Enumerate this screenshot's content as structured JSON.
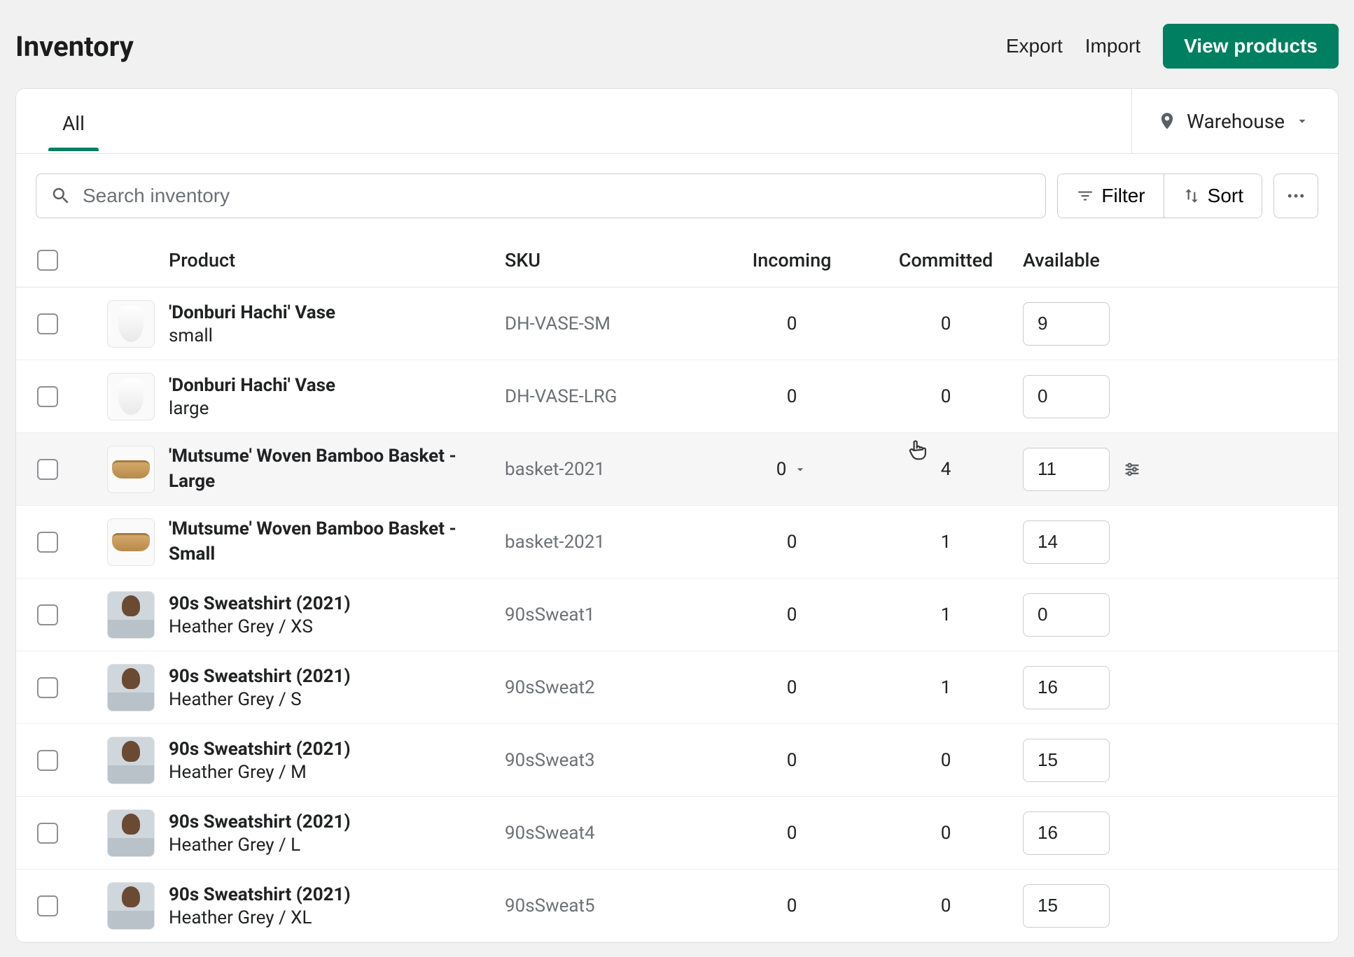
{
  "header": {
    "title": "Inventory",
    "export": "Export",
    "import": "Import",
    "view_products": "View products"
  },
  "tabs": {
    "all": "All"
  },
  "location": {
    "label": "Warehouse"
  },
  "toolbar": {
    "search_placeholder": "Search inventory",
    "filter": "Filter",
    "sort": "Sort"
  },
  "columns": {
    "product": "Product",
    "sku": "SKU",
    "incoming": "Incoming",
    "committed": "Committed",
    "available": "Available"
  },
  "rows": [
    {
      "name": "'Donburi Hachi' Vase",
      "variant": "small",
      "sku": "DH-VASE-SM",
      "incoming": "0",
      "committed": "0",
      "available": "9",
      "thumb": "vase"
    },
    {
      "name": "'Donburi Hachi' Vase",
      "variant": "large",
      "sku": "DH-VASE-LRG",
      "incoming": "0",
      "committed": "0",
      "available": "0",
      "thumb": "vase"
    },
    {
      "name": "'Mutsume' Woven Bamboo Basket - Large",
      "variant": "",
      "sku": "basket-2021",
      "incoming": "0",
      "committed": "4",
      "available": "11",
      "thumb": "basket",
      "hovered": true
    },
    {
      "name": "'Mutsume' Woven Bamboo Basket - Small",
      "variant": "",
      "sku": "basket-2021",
      "incoming": "0",
      "committed": "1",
      "available": "14",
      "thumb": "basket"
    },
    {
      "name": "90s Sweatshirt (2021)",
      "variant": "Heather Grey / XS",
      "sku": "90sSweat1",
      "incoming": "0",
      "committed": "1",
      "available": "0",
      "thumb": "person"
    },
    {
      "name": "90s Sweatshirt (2021)",
      "variant": "Heather Grey / S",
      "sku": "90sSweat2",
      "incoming": "0",
      "committed": "1",
      "available": "16",
      "thumb": "person"
    },
    {
      "name": "90s Sweatshirt (2021)",
      "variant": "Heather Grey / M",
      "sku": "90sSweat3",
      "incoming": "0",
      "committed": "0",
      "available": "15",
      "thumb": "person"
    },
    {
      "name": "90s Sweatshirt (2021)",
      "variant": "Heather Grey / L",
      "sku": "90sSweat4",
      "incoming": "0",
      "committed": "0",
      "available": "16",
      "thumb": "person"
    },
    {
      "name": "90s Sweatshirt (2021)",
      "variant": "Heather Grey / XL",
      "sku": "90sSweat5",
      "incoming": "0",
      "committed": "0",
      "available": "15",
      "thumb": "person"
    }
  ]
}
